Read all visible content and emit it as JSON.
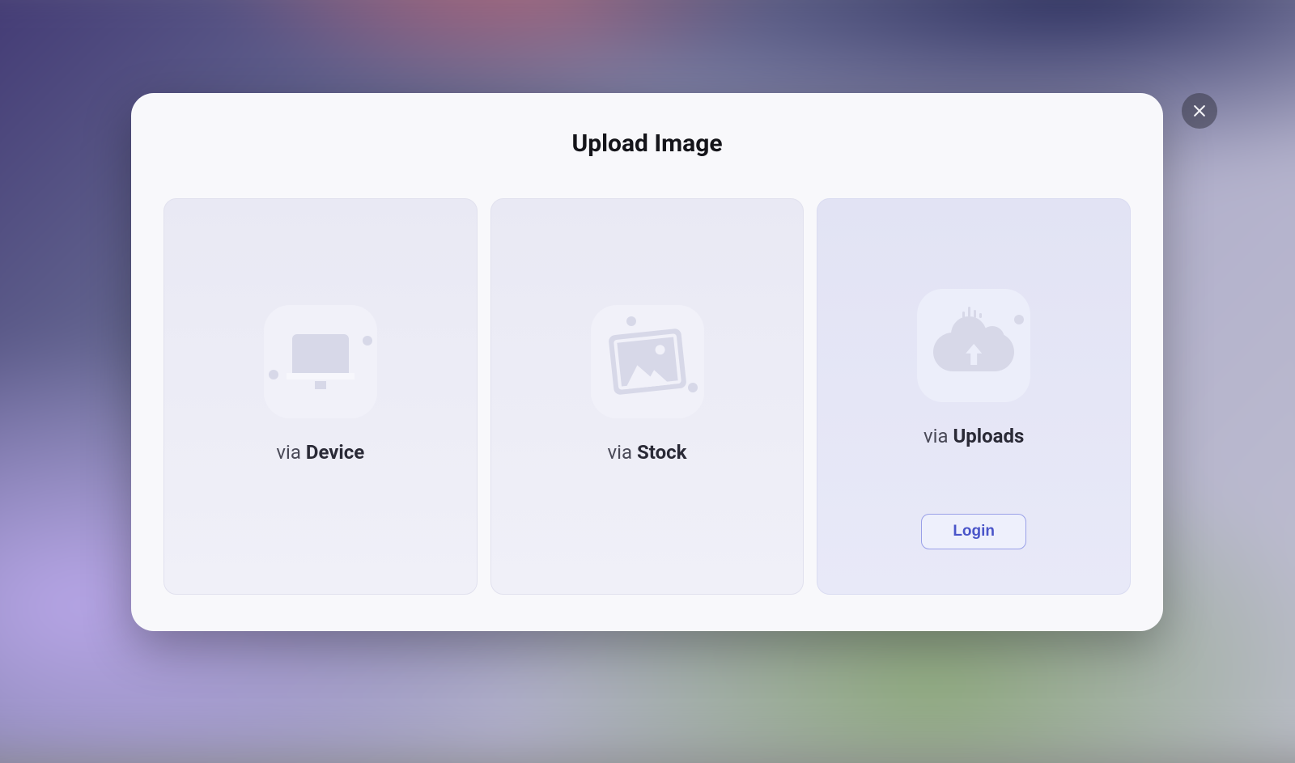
{
  "modal": {
    "title": "Upload Image"
  },
  "cards": {
    "device": {
      "pre": "via ",
      "strong": "Device"
    },
    "stock": {
      "pre": "via ",
      "strong": "Stock"
    },
    "uploads": {
      "pre": "via ",
      "strong": "Uploads",
      "login_label": "Login"
    }
  }
}
